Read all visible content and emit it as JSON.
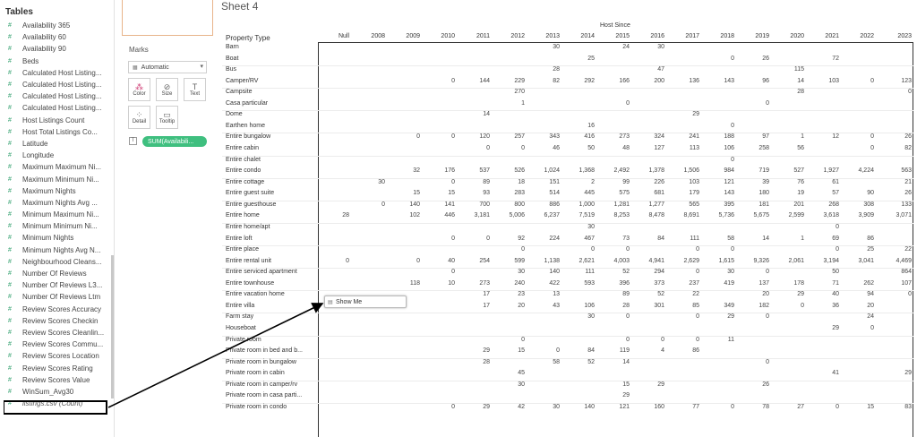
{
  "data_pane": {
    "title": "Tables",
    "fields": [
      "Availability 365",
      "Availability 60",
      "Availability 90",
      "Beds",
      "Calculated Host Listing...",
      "Calculated Host Listing...",
      "Calculated Host Listing...",
      "Calculated Host Listing...",
      "Host Listings Count",
      "Host Total Listings Co...",
      "Latitude",
      "Longitude",
      "Maximum Maximum Ni...",
      "Maximum Minimum Ni...",
      "Maximum Nights",
      "Maximum Nights Avg ...",
      "Minimum Maximum Ni...",
      "Minimum Minimum Ni...",
      "Minimum Nights",
      "Minimum Nights Avg N...",
      "Neighbourhood Cleans...",
      "Number Of Reviews",
      "Number Of Reviews L3...",
      "Number Of Reviews Ltm",
      "Review Scores Accuracy",
      "Review Scores Checkin",
      "Review Scores Cleanlin...",
      "Review Scores Commu...",
      "Review Scores Location",
      "Review Scores Rating",
      "Review Scores Value",
      "WinSum_Avg30",
      "listings.csv (Count)"
    ]
  },
  "marks": {
    "label": "Marks",
    "type": "Automatic",
    "buttons": [
      "Color",
      "Size",
      "Text",
      "Detail",
      "Tooltip"
    ],
    "pill": "SUM(Availabili..."
  },
  "view": {
    "sheet_title": "Sheet 4",
    "column_group": "Host Since",
    "row_header": "Property Type",
    "years": [
      "Null",
      "2008",
      "2009",
      "2010",
      "2011",
      "2012",
      "2013",
      "2014",
      "2015",
      "2016",
      "2017",
      "2018",
      "2019",
      "2020",
      "2021",
      "2022",
      "2023"
    ],
    "show_me": "Show Me",
    "rows": [
      {
        "label": "Barn",
        "cells": [
          "",
          "",
          "",
          "",
          "",
          "",
          "30",
          "",
          "24",
          "30",
          "",
          "",
          "",
          "",
          "",
          "",
          ""
        ]
      },
      {
        "label": "Boat",
        "cells": [
          "",
          "",
          "",
          "",
          "",
          "",
          "",
          "25",
          "",
          "",
          "",
          "0",
          "26",
          "",
          "72",
          "",
          ""
        ]
      },
      {
        "label": "Bus",
        "cells": [
          "",
          "",
          "",
          "",
          "",
          "",
          "28",
          "",
          "",
          "47",
          "",
          "",
          "",
          "115",
          "",
          "",
          ""
        ]
      },
      {
        "label": "Camper/RV",
        "cells": [
          "",
          "",
          "",
          "0",
          "144",
          "229",
          "82",
          "292",
          "166",
          "200",
          "136",
          "143",
          "96",
          "14",
          "103",
          "0",
          "123"
        ]
      },
      {
        "label": "Campsite",
        "cells": [
          "",
          "",
          "",
          "",
          "",
          "270",
          "",
          "",
          "",
          "",
          "",
          "",
          "",
          "28",
          "",
          "",
          "0"
        ]
      },
      {
        "label": "Casa particular",
        "cells": [
          "",
          "",
          "",
          "",
          "",
          "1",
          "",
          "",
          "0",
          "",
          "",
          "",
          "0",
          "",
          "",
          "",
          ""
        ]
      },
      {
        "label": "Dome",
        "cells": [
          "",
          "",
          "",
          "",
          "14",
          "",
          "",
          "",
          "",
          "",
          "29",
          "",
          "",
          "",
          "",
          "",
          ""
        ]
      },
      {
        "label": "Earthen home",
        "cells": [
          "",
          "",
          "",
          "",
          "",
          "",
          "",
          "16",
          "",
          "",
          "",
          "0",
          "",
          "",
          "",
          "",
          ""
        ]
      },
      {
        "label": "Entire bungalow",
        "cells": [
          "",
          "",
          "0",
          "0",
          "120",
          "257",
          "343",
          "416",
          "273",
          "324",
          "241",
          "188",
          "97",
          "1",
          "12",
          "0",
          "26"
        ]
      },
      {
        "label": "Entire cabin",
        "cells": [
          "",
          "",
          "",
          "",
          "0",
          "0",
          "46",
          "50",
          "48",
          "127",
          "113",
          "106",
          "258",
          "56",
          "",
          "0",
          "82"
        ]
      },
      {
        "label": "Entire chalet",
        "cells": [
          "",
          "",
          "",
          "",
          "",
          "",
          "",
          "",
          "",
          "",
          "",
          "0",
          "",
          "",
          "",
          "",
          ""
        ]
      },
      {
        "label": "Entire condo",
        "cells": [
          "",
          "",
          "32",
          "176",
          "537",
          "526",
          "1,024",
          "1,368",
          "2,492",
          "1,378",
          "1,506",
          "984",
          "719",
          "527",
          "1,927",
          "4,224",
          "563"
        ]
      },
      {
        "label": "Entire cottage",
        "cells": [
          "",
          "30",
          "",
          "0",
          "89",
          "18",
          "151",
          "2",
          "99",
          "226",
          "103",
          "121",
          "39",
          "76",
          "61",
          "",
          "21"
        ]
      },
      {
        "label": "Entire guest suite",
        "cells": [
          "",
          "",
          "15",
          "15",
          "93",
          "283",
          "514",
          "445",
          "575",
          "681",
          "179",
          "143",
          "180",
          "19",
          "57",
          "90",
          "26"
        ]
      },
      {
        "label": "Entire guesthouse",
        "cells": [
          "",
          "0",
          "140",
          "141",
          "700",
          "800",
          "886",
          "1,000",
          "1,281",
          "1,277",
          "565",
          "395",
          "181",
          "201",
          "268",
          "308",
          "133"
        ]
      },
      {
        "label": "Entire home",
        "cells": [
          "28",
          "",
          "102",
          "446",
          "3,181",
          "5,006",
          "6,237",
          "7,519",
          "8,253",
          "8,478",
          "8,691",
          "5,736",
          "5,675",
          "2,599",
          "3,618",
          "3,909",
          "3,071"
        ]
      },
      {
        "label": "Entire home/apt",
        "cells": [
          "",
          "",
          "",
          "",
          "",
          "",
          "",
          "30",
          "",
          "",
          "",
          "",
          "",
          "",
          "0",
          "",
          ""
        ]
      },
      {
        "label": "Entire loft",
        "cells": [
          "",
          "",
          "",
          "0",
          "0",
          "92",
          "224",
          "467",
          "73",
          "84",
          "111",
          "58",
          "14",
          "1",
          "69",
          "86",
          ""
        ]
      },
      {
        "label": "Entire place",
        "cells": [
          "",
          "",
          "",
          "",
          "",
          "0",
          "",
          "0",
          "0",
          "",
          "0",
          "0",
          "",
          "",
          "0",
          "25",
          "22"
        ]
      },
      {
        "label": "Entire rental unit",
        "cells": [
          "0",
          "",
          "0",
          "40",
          "254",
          "599",
          "1,138",
          "2,621",
          "4,003",
          "4,941",
          "2,629",
          "1,615",
          "9,326",
          "2,061",
          "3,194",
          "3,041",
          "4,469"
        ]
      },
      {
        "label": "Entire serviced apartment",
        "cells": [
          "",
          "",
          "",
          "0",
          "",
          "30",
          "140",
          "111",
          "52",
          "294",
          "0",
          "30",
          "0",
          "",
          "50",
          "",
          "864"
        ]
      },
      {
        "label": "Entire townhouse",
        "cells": [
          "",
          "",
          "118",
          "10",
          "273",
          "240",
          "422",
          "593",
          "396",
          "373",
          "237",
          "419",
          "137",
          "178",
          "71",
          "262",
          "107"
        ]
      },
      {
        "label": "Entire vacation home",
        "cells": [
          "",
          "",
          "",
          "",
          "17",
          "23",
          "13",
          "",
          "89",
          "52",
          "22",
          "",
          "20",
          "29",
          "40",
          "94",
          "0"
        ]
      },
      {
        "label": "Entire villa",
        "cells": [
          "",
          "",
          "",
          "",
          "17",
          "20",
          "43",
          "106",
          "28",
          "301",
          "85",
          "349",
          "182",
          "0",
          "36",
          "20",
          ""
        ]
      },
      {
        "label": "Farm stay",
        "cells": [
          "",
          "",
          "",
          "",
          "",
          "",
          "",
          "30",
          "0",
          "",
          "0",
          "29",
          "0",
          "",
          "",
          "24",
          ""
        ]
      },
      {
        "label": "Houseboat",
        "cells": [
          "",
          "",
          "",
          "",
          "",
          "",
          "",
          "",
          "",
          "",
          "",
          "",
          "",
          "",
          "29",
          "0",
          ""
        ]
      },
      {
        "label": "Private room",
        "cells": [
          "",
          "",
          "",
          "",
          "",
          "0",
          "",
          "",
          "0",
          "0",
          "0",
          "11",
          "",
          "",
          "",
          "",
          ""
        ]
      },
      {
        "label": "Private room in bed and b...",
        "cells": [
          "",
          "",
          "",
          "",
          "29",
          "15",
          "0",
          "84",
          "119",
          "4",
          "86",
          "",
          "",
          "",
          "",
          "",
          ""
        ]
      },
      {
        "label": "Private room in bungalow",
        "cells": [
          "",
          "",
          "",
          "",
          "28",
          "",
          "58",
          "52",
          "14",
          "",
          "",
          "",
          "0",
          "",
          "",
          "",
          ""
        ]
      },
      {
        "label": "Private room in cabin",
        "cells": [
          "",
          "",
          "",
          "",
          "",
          "45",
          "",
          "",
          "",
          "",
          "",
          "",
          "",
          "",
          "41",
          "",
          "29"
        ]
      },
      {
        "label": "Private room in camper/rv",
        "cells": [
          "",
          "",
          "",
          "",
          "",
          "30",
          "",
          "",
          "15",
          "29",
          "",
          "",
          "26",
          "",
          "",
          "",
          ""
        ]
      },
      {
        "label": "Private room in casa parti...",
        "cells": [
          "",
          "",
          "",
          "",
          "",
          "",
          "",
          "",
          "29",
          "",
          "",
          "",
          "",
          "",
          "",
          "",
          ""
        ]
      },
      {
        "label": "Private room in condo",
        "cells": [
          "",
          "",
          "",
          "0",
          "29",
          "42",
          "30",
          "140",
          "121",
          "160",
          "77",
          "0",
          "78",
          "27",
          "0",
          "15",
          "83"
        ]
      }
    ]
  }
}
